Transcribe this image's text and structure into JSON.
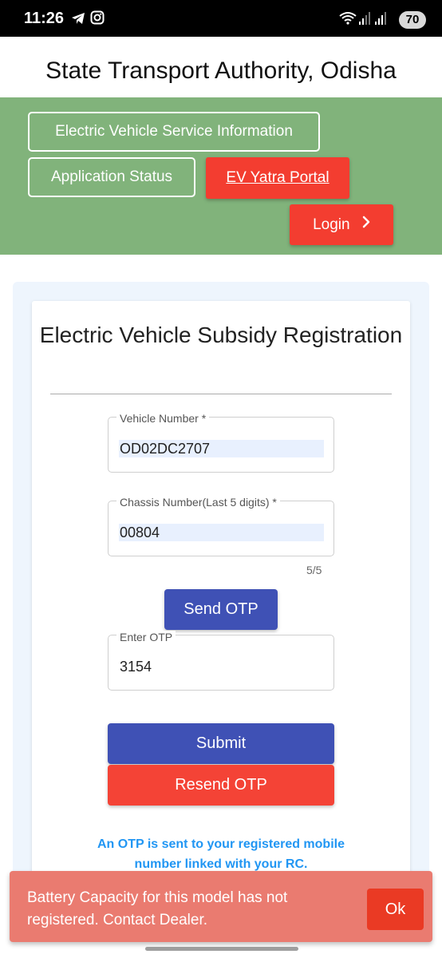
{
  "status_bar": {
    "time": "11:26",
    "battery": "70",
    "icons": [
      "telegram-icon",
      "instagram-icon",
      "wifi-icon",
      "signal-icon",
      "signal-icon"
    ]
  },
  "header": {
    "title": "State Transport Authority, Odisha"
  },
  "nav": {
    "ev_service_info": "Electric Vehicle Service Information",
    "application_status": "Application Status",
    "ev_yatra_portal": "EV Yatra Portal",
    "login": "Login",
    "login_icon": "chevron-right-icon",
    "band_color": "#81b37b",
    "button_red": "#f33d30"
  },
  "form": {
    "title": "Electric Vehicle Subsidy Registration",
    "vehicle_number": {
      "label": "Vehicle Number *",
      "value": "OD02DC2707"
    },
    "chassis_number": {
      "label": "Chassis Number(Last 5 digits) *",
      "value": "00804",
      "counter": "5/5"
    },
    "send_otp": "Send OTP",
    "otp": {
      "label": "Enter OTP",
      "value": "3154"
    },
    "submit": "Submit",
    "resend_otp": "Resend OTP",
    "info": "An OTP is sent to your registered mobile number linked with your RC.",
    "primary_color": "#3f51b5",
    "danger_color": "#f44336",
    "info_color": "#2196f3"
  },
  "snackbar": {
    "message": "Battery Capacity for this model has not registered. Contact Dealer.",
    "action": "Ok",
    "bg_color": "#ea7b70"
  }
}
